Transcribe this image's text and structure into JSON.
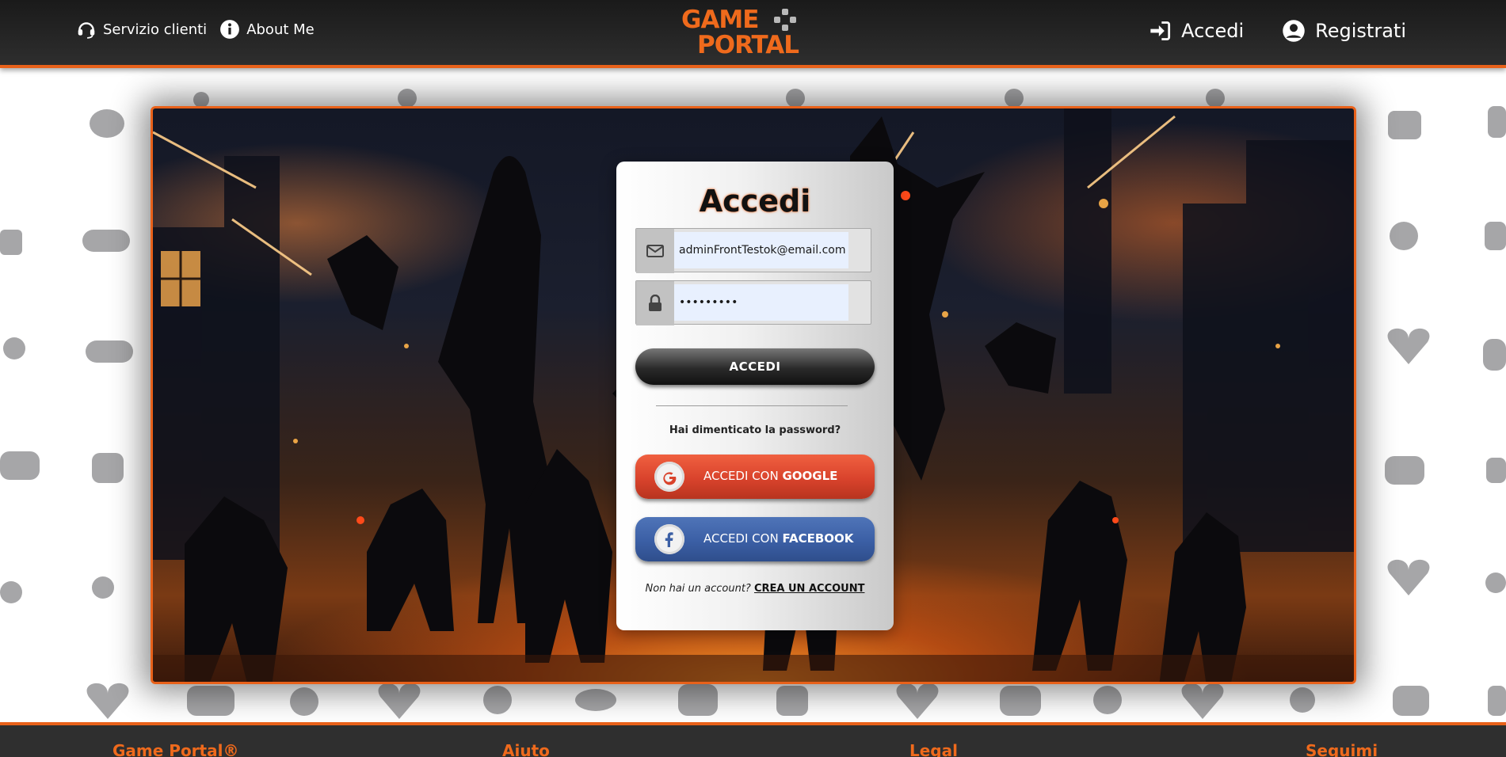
{
  "header": {
    "brand_line1": "GAME",
    "brand_line2": "PORTAL",
    "nav_left": [
      {
        "label": "Servizio clienti",
        "icon": "headset-icon"
      },
      {
        "label": "About Me",
        "icon": "info-icon"
      }
    ],
    "nav_right": [
      {
        "label": "Accedi",
        "icon": "sign-in-icon"
      },
      {
        "label": "Registrati",
        "icon": "user-circle-icon"
      }
    ]
  },
  "login": {
    "title": "Accedi",
    "email_value": "adminFrontTestok@email.com",
    "email_icon": "envelope-icon",
    "password_value": "123456789",
    "password_icon": "lock-icon",
    "submit_label": "ACCEDI",
    "forgot_label": "Hai dimenticato la password?",
    "google_prefix": "ACCEDI CON ",
    "google_brand": "GOOGLE",
    "facebook_prefix": "ACCEDI CON ",
    "facebook_brand": "FACEBOOK",
    "signup_question": "Non hai un account?",
    "signup_link": "CREA UN ACCOUNT"
  },
  "footer": {
    "columns": [
      "Game Portal®",
      "Aiuto",
      "Legal",
      "Seguimi"
    ]
  },
  "colors": {
    "accent": "#e8611a",
    "header_bg": "#1f1f1f",
    "google": "#d9432c",
    "facebook": "#3b5fa5"
  }
}
